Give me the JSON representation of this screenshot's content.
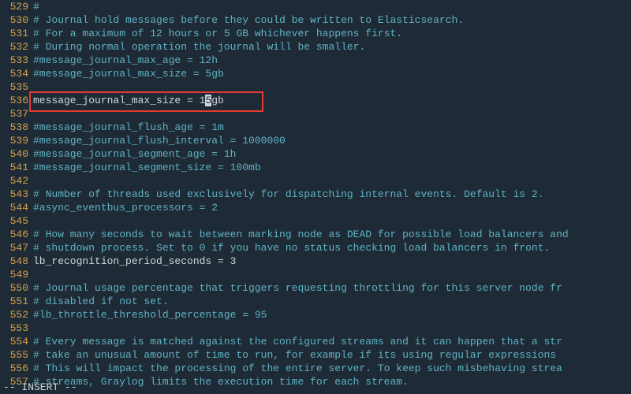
{
  "status": {
    "mode": "-- INSERT --"
  },
  "cursor": {
    "lineno": 536,
    "col_before": "message_journal_max_size = 1",
    "cursor_char": "5",
    "col_after": "gb"
  },
  "lines": [
    {
      "n": 529,
      "cls": "comment",
      "text": "#"
    },
    {
      "n": 530,
      "cls": "comment",
      "text": "# Journal hold messages before they could be written to Elasticsearch."
    },
    {
      "n": 531,
      "cls": "comment",
      "text": "# For a maximum of 12 hours or 5 GB whichever happens first."
    },
    {
      "n": 532,
      "cls": "comment",
      "text": "# During normal operation the journal will be smaller."
    },
    {
      "n": 533,
      "cls": "comment",
      "text": "#message_journal_max_age = 12h"
    },
    {
      "n": 534,
      "cls": "comment",
      "text": "#message_journal_max_size = 5gb"
    },
    {
      "n": 535,
      "cls": "comment",
      "text": ""
    },
    {
      "n": 536,
      "cls": "plain",
      "text": "CURSOR_LINE"
    },
    {
      "n": 537,
      "cls": "comment",
      "text": ""
    },
    {
      "n": 538,
      "cls": "comment",
      "text": "#message_journal_flush_age = 1m"
    },
    {
      "n": 539,
      "cls": "comment",
      "text": "#message_journal_flush_interval = 1000000"
    },
    {
      "n": 540,
      "cls": "comment",
      "text": "#message_journal_segment_age = 1h"
    },
    {
      "n": 541,
      "cls": "comment",
      "text": "#message_journal_segment_size = 100mb"
    },
    {
      "n": 542,
      "cls": "comment",
      "text": ""
    },
    {
      "n": 543,
      "cls": "comment",
      "text": "# Number of threads used exclusively for dispatching internal events. Default is 2."
    },
    {
      "n": 544,
      "cls": "comment",
      "text": "#async_eventbus_processors = 2"
    },
    {
      "n": 545,
      "cls": "comment",
      "text": ""
    },
    {
      "n": 546,
      "cls": "comment",
      "text": "# How many seconds to wait between marking node as DEAD for possible load balancers and"
    },
    {
      "n": 547,
      "cls": "comment",
      "text": "# shutdown process. Set to 0 if you have no status checking load balancers in front."
    },
    {
      "n": 548,
      "cls": "plain",
      "text": "lb_recognition_period_seconds = 3"
    },
    {
      "n": 549,
      "cls": "comment",
      "text": ""
    },
    {
      "n": 550,
      "cls": "comment",
      "text": "# Journal usage percentage that triggers requesting throttling for this server node fr"
    },
    {
      "n": 551,
      "cls": "comment",
      "text": "# disabled if not set."
    },
    {
      "n": 552,
      "cls": "comment",
      "text": "#lb_throttle_threshold_percentage = 95"
    },
    {
      "n": 553,
      "cls": "comment",
      "text": ""
    },
    {
      "n": 554,
      "cls": "comment",
      "text": "# Every message is matched against the configured streams and it can happen that a str"
    },
    {
      "n": 555,
      "cls": "comment",
      "text": "# take an unusual amount of time to run, for example if its using regular expressions "
    },
    {
      "n": 556,
      "cls": "comment",
      "text": "# This will impact the processing of the entire server. To keep such misbehaving strea"
    },
    {
      "n": 557,
      "cls": "comment",
      "text": "# streams, Graylog limits the execution time for each stream."
    }
  ]
}
